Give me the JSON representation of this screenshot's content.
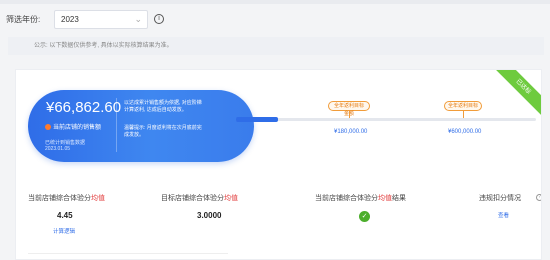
{
  "filter": {
    "label": "筛选年份:",
    "year_value": "2023"
  },
  "notice": "公示: 以下数据仅供参考, 具体以实际核算结果为准。",
  "ribbon": "已达标",
  "panel": {
    "amount": "¥66,862.60",
    "shop_name": "当前店铺的销售额",
    "stat_desc": "已统计到销售数据",
    "stat_date": "2023.01.05",
    "rule_1": "以达成累计销售额为依据, 对应阶梯计算返利, 达成后自动发放。",
    "rule_2": "温馨提示: 月度返利将在次月底前完成发放。"
  },
  "tiers": [
    {
      "label": "全年返利目标金额",
      "amount": "¥180,000.00"
    },
    {
      "label": "全年返利目标",
      "amount": "¥600,000.00"
    }
  ],
  "progress": {
    "fraction": 0.14
  },
  "metrics": [
    {
      "label_pre": "当前店铺综合体验分",
      "label_hl": "均值",
      "value": "4.45",
      "link": "计算逻辑"
    },
    {
      "label_pre": "目标店铺综合体验分",
      "label_hl": "均值",
      "value": "3.0000"
    },
    {
      "label_pre": "当前店铺综合体验分",
      "label_hl": "均值",
      "label_post": "结果"
    },
    {
      "label_pre": "违规扣分情况",
      "link": "查看"
    }
  ],
  "colors": {
    "primary": "#2f6de8",
    "highlight": "#e23b3b",
    "success": "#4cae2c",
    "tier": "#e67b12"
  }
}
